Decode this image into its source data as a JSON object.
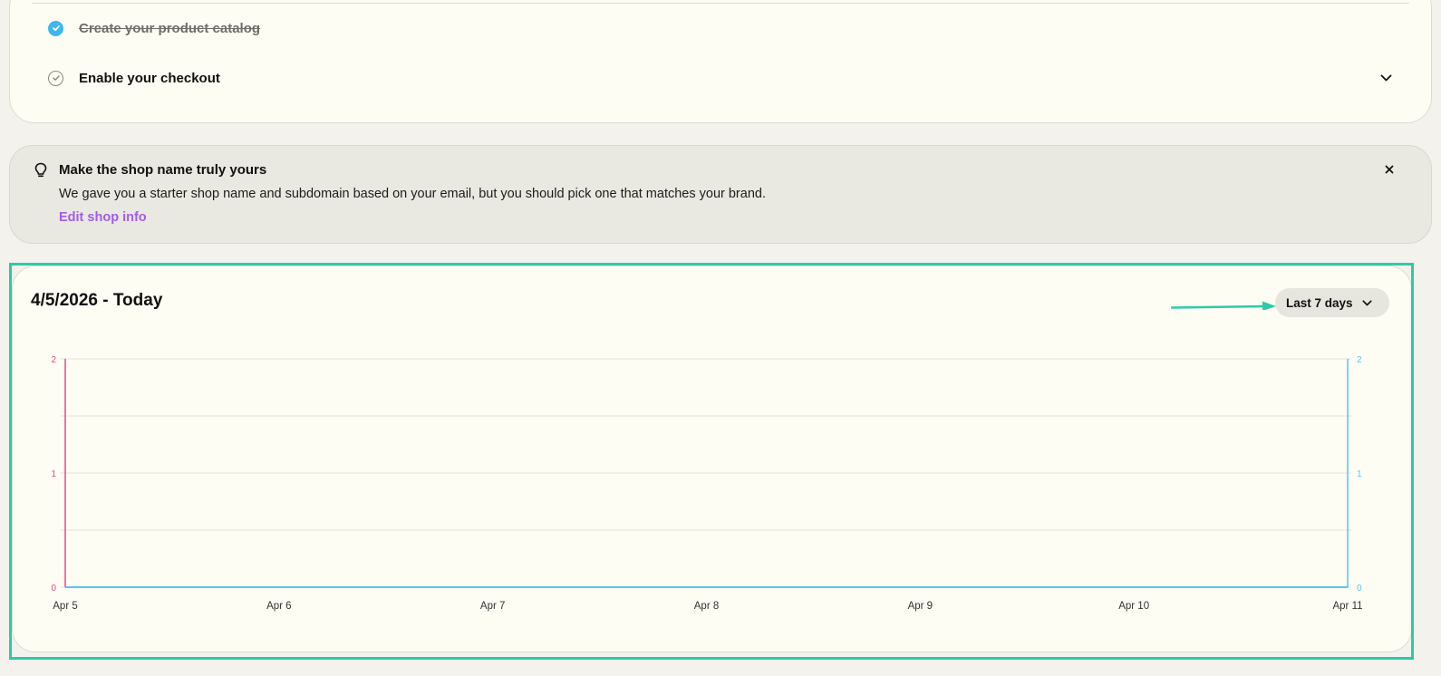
{
  "setup": {
    "tasks": [
      {
        "label": "Create your product catalog",
        "done": true
      },
      {
        "label": "Enable your checkout",
        "done": false
      }
    ]
  },
  "tip": {
    "title": "Make the shop name truly yours",
    "text": "We gave you a starter shop name and subdomain based on your email, but you should pick one that matches your brand.",
    "link": "Edit shop info"
  },
  "dashboard": {
    "range_title": "4/5/2026 - Today",
    "range_select": "Last 7 days"
  },
  "colors": {
    "left_axis": "#e8478f",
    "right_axis": "#57c4ee",
    "highlight": "#2ecaa6",
    "link": "#a35ce8"
  },
  "chart_data": {
    "type": "line",
    "categories": [
      "Apr 5",
      "Apr 6",
      "Apr 7",
      "Apr 8",
      "Apr 9",
      "Apr 10",
      "Apr 11"
    ],
    "series": [
      {
        "values": [
          0,
          0,
          0,
          0,
          0,
          0,
          0
        ],
        "color": "#e8478f",
        "axis": "left"
      },
      {
        "values": [
          0,
          0,
          0,
          0,
          0,
          0,
          0
        ],
        "color": "#57c4ee",
        "axis": "right"
      }
    ],
    "y_left": {
      "ticks": [
        "0",
        "1",
        "2"
      ],
      "lim": [
        0,
        2
      ]
    },
    "y_right": {
      "ticks": [
        "0",
        "1",
        "2"
      ],
      "lim": [
        0,
        2
      ]
    },
    "grid": true
  }
}
